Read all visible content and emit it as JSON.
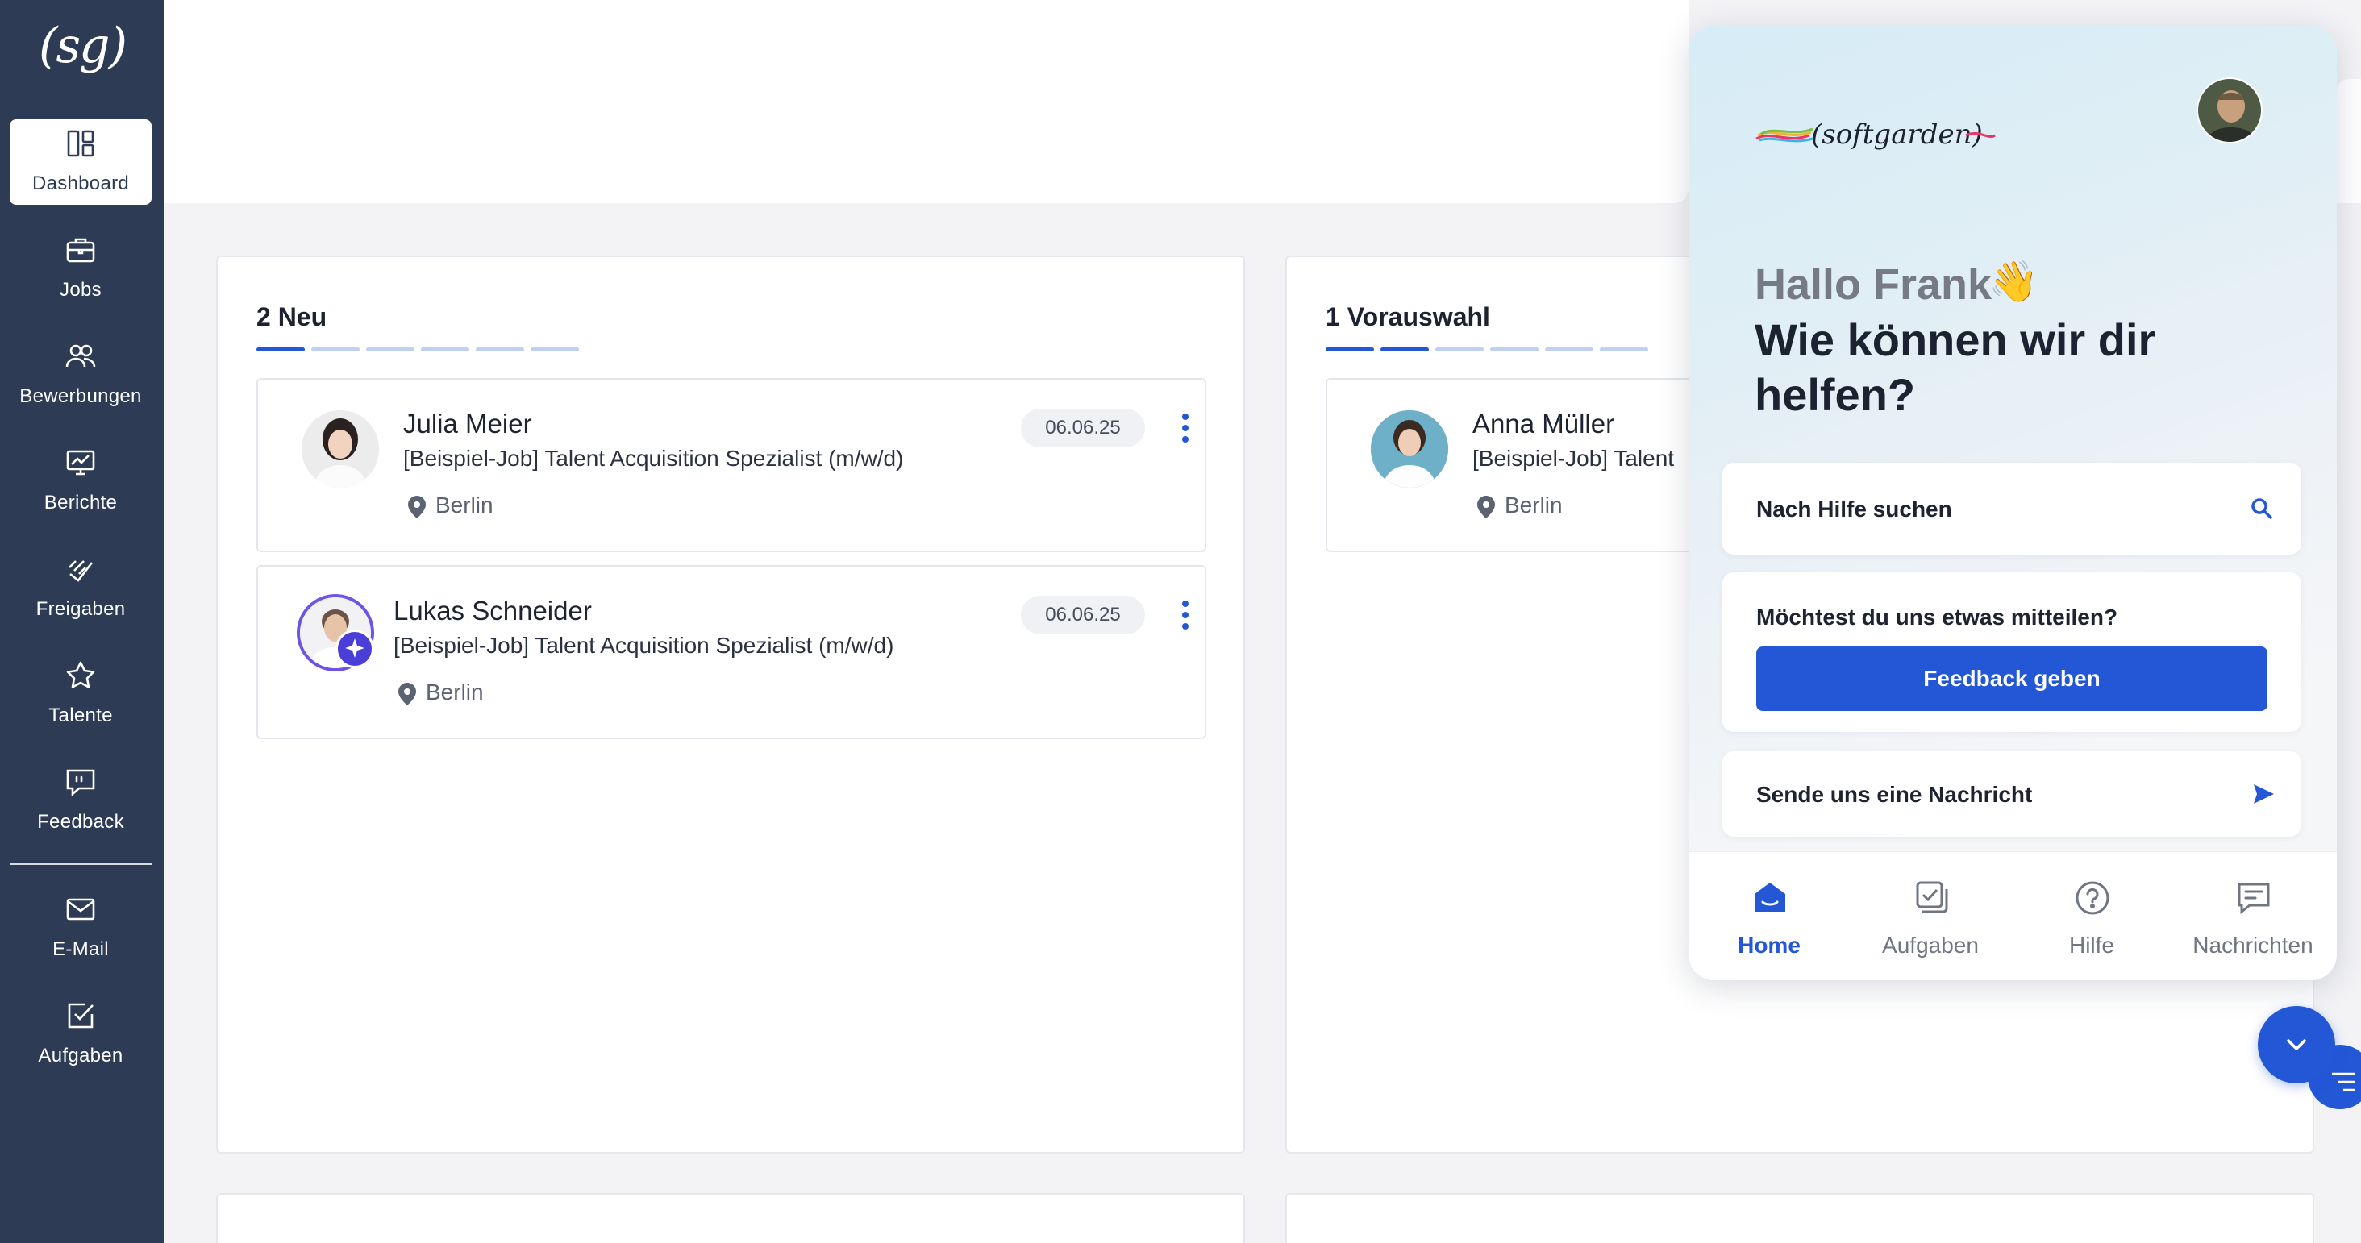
{
  "sidebar": {
    "logo": "(sg)",
    "items": [
      {
        "label": "Dashboard",
        "icon": "dashboard-icon"
      },
      {
        "label": "Jobs",
        "icon": "briefcase-icon"
      },
      {
        "label": "Bewerbungen",
        "icon": "users-icon"
      },
      {
        "label": "Berichte",
        "icon": "chart-icon"
      },
      {
        "label": "Freigaben",
        "icon": "approval-icon"
      },
      {
        "label": "Talente",
        "icon": "star-icon"
      },
      {
        "label": "Feedback",
        "icon": "feedback-icon"
      },
      {
        "label": "E-Mail",
        "icon": "mail-icon"
      },
      {
        "label": "Aufgaben",
        "icon": "tasks-icon"
      }
    ]
  },
  "columns": [
    {
      "title": "2 Neu",
      "cards": [
        {
          "name": "Julia Meier",
          "job": "[Beispiel-Job] Talent Acquisition Spezialist (m/w/d)",
          "location": "Berlin",
          "date": "06.06.25"
        },
        {
          "name": "Lukas Schneider",
          "job": "[Beispiel-Job] Talent Acquisition Spezialist (m/w/d)",
          "location": "Berlin",
          "date": "06.06.25"
        }
      ]
    },
    {
      "title": "1 Vorauswahl",
      "cards": [
        {
          "name": "Anna Müller",
          "job": "[Beispiel-Job] Talent",
          "location": "Berlin"
        }
      ]
    }
  ],
  "widget": {
    "brand": "(softgarden)",
    "greeting": "Hallo Frank",
    "wave": "👋",
    "headline": "Wie können wir dir helfen?",
    "search_label": "Nach Hilfe suchen",
    "feedback_question": "Möchtest du uns etwas mitteilen?",
    "feedback_button": "Feedback geben",
    "message_label": "Sende uns eine Nachricht",
    "tabs": [
      {
        "label": "Home",
        "icon": "home-icon"
      },
      {
        "label": "Aufgaben",
        "icon": "tasks-icon"
      },
      {
        "label": "Hilfe",
        "icon": "help-icon"
      },
      {
        "label": "Nachrichten",
        "icon": "messages-icon"
      }
    ]
  },
  "colors": {
    "sidebar": "#2d3b54",
    "accent": "#2357d6",
    "stage_inactive": "#bfd0f3"
  }
}
